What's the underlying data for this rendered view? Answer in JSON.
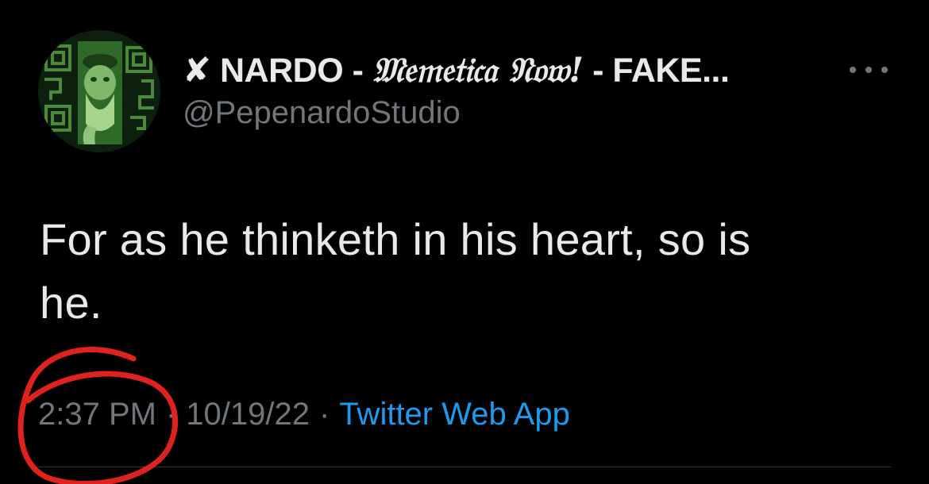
{
  "author": {
    "prefix": "✘ NARDO - ",
    "gothic": "𝔐𝔢𝔪𝔢𝔱𝔦𝔠𝔞 𝔑𝔬𝔴!",
    "suffix": " - FAKE...",
    "handle": "@PepenardoStudio",
    "avatar_icon": "green-portrait-avatar"
  },
  "more_icon": "more-options-icon",
  "tweet": {
    "line1": "For as he thinketh in his heart, so is",
    "line2": "he."
  },
  "meta": {
    "time": "2:37 PM",
    "separator": "·",
    "date": "10/19/22",
    "source": "Twitter Web App"
  },
  "annotation": {
    "color": "#e0221e",
    "icon": "red-circle-annotation"
  },
  "colors": {
    "background": "#000000",
    "primary_text": "#e7e9ea",
    "secondary_text": "#71767b",
    "link": "#1d9bf0"
  }
}
